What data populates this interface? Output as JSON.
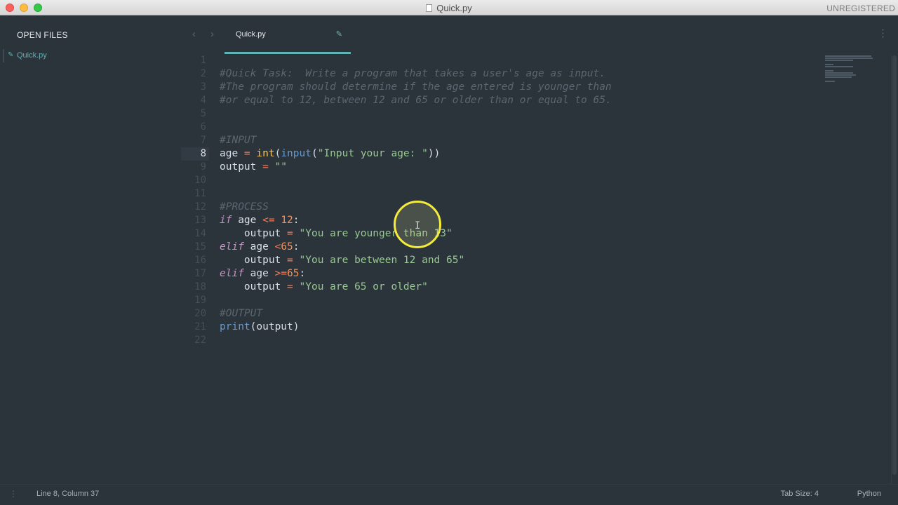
{
  "window": {
    "title": "Quick.py",
    "license_status": "UNREGISTERED"
  },
  "sidebar": {
    "header": "OPEN FILES",
    "files": [
      {
        "name": "Quick.py",
        "icon": "pencil-icon"
      }
    ]
  },
  "tabs": [
    {
      "label": "Quick.py",
      "icon": "pencil-icon"
    }
  ],
  "editor": {
    "active_line": 8,
    "line_numbers": [
      "1",
      "2",
      "3",
      "4",
      "5",
      "6",
      "7",
      "8",
      "9",
      "10",
      "11",
      "12",
      "13",
      "14",
      "15",
      "16",
      "17",
      "18",
      "19",
      "20",
      "21",
      "22"
    ],
    "lines": [
      [],
      [
        {
          "t": "comment",
          "v": "#Quick Task:  Write a program that takes a user's age as input."
        }
      ],
      [
        {
          "t": "comment",
          "v": "#The program should determine if the age entered is younger than"
        }
      ],
      [
        {
          "t": "comment",
          "v": "#or equal to 12, between 12 and 65 or older than or equal to 65."
        }
      ],
      [],
      [],
      [
        {
          "t": "comment",
          "v": "#INPUT"
        }
      ],
      [
        {
          "t": "plain",
          "v": "age "
        },
        {
          "t": "op",
          "v": "="
        },
        {
          "t": "plain",
          "v": " "
        },
        {
          "t": "fn",
          "v": "int"
        },
        {
          "t": "plain",
          "v": "("
        },
        {
          "t": "fn2",
          "v": "input"
        },
        {
          "t": "plain",
          "v": "("
        },
        {
          "t": "str",
          "v": "\"Input your age: \""
        },
        {
          "t": "plain",
          "v": "))"
        }
      ],
      [
        {
          "t": "plain",
          "v": "output "
        },
        {
          "t": "op",
          "v": "="
        },
        {
          "t": "plain",
          "v": " "
        },
        {
          "t": "str",
          "v": "\"\""
        }
      ],
      [],
      [],
      [
        {
          "t": "comment",
          "v": "#PROCESS"
        }
      ],
      [
        {
          "t": "kw",
          "v": "if"
        },
        {
          "t": "plain",
          "v": " age "
        },
        {
          "t": "op",
          "v": "<="
        },
        {
          "t": "plain",
          "v": " "
        },
        {
          "t": "num",
          "v": "12"
        },
        {
          "t": "plain",
          "v": ":"
        }
      ],
      [
        {
          "t": "plain",
          "v": "    output "
        },
        {
          "t": "op",
          "v": "="
        },
        {
          "t": "plain",
          "v": " "
        },
        {
          "t": "str",
          "v": "\"You are younger than 13\""
        }
      ],
      [
        {
          "t": "kw",
          "v": "elif"
        },
        {
          "t": "plain",
          "v": " age "
        },
        {
          "t": "op",
          "v": "<"
        },
        {
          "t": "num",
          "v": "65"
        },
        {
          "t": "plain",
          "v": ":"
        }
      ],
      [
        {
          "t": "plain",
          "v": "    output "
        },
        {
          "t": "op",
          "v": "="
        },
        {
          "t": "plain",
          "v": " "
        },
        {
          "t": "str",
          "v": "\"You are between 12 and 65\""
        }
      ],
      [
        {
          "t": "kw",
          "v": "elif"
        },
        {
          "t": "plain",
          "v": " age "
        },
        {
          "t": "op",
          "v": ">="
        },
        {
          "t": "num",
          "v": "65"
        },
        {
          "t": "plain",
          "v": ":"
        }
      ],
      [
        {
          "t": "plain",
          "v": "    output "
        },
        {
          "t": "op",
          "v": "="
        },
        {
          "t": "plain",
          "v": " "
        },
        {
          "t": "str",
          "v": "\"You are 65 or older\""
        }
      ],
      [],
      [
        {
          "t": "comment",
          "v": "#OUTPUT"
        }
      ],
      [
        {
          "t": "fn2",
          "v": "print"
        },
        {
          "t": "plain",
          "v": "(output)"
        }
      ],
      []
    ]
  },
  "statusbar": {
    "position": "Line 8, Column 37",
    "tab_size": "Tab Size: 4",
    "syntax": "Python"
  },
  "colors": {
    "background": "#2b333b",
    "accent": "#5fb3b3",
    "comment": "#5b6670",
    "keyword": "#c594c5",
    "string": "#99c794",
    "number": "#f99157",
    "function": "#fac863"
  }
}
